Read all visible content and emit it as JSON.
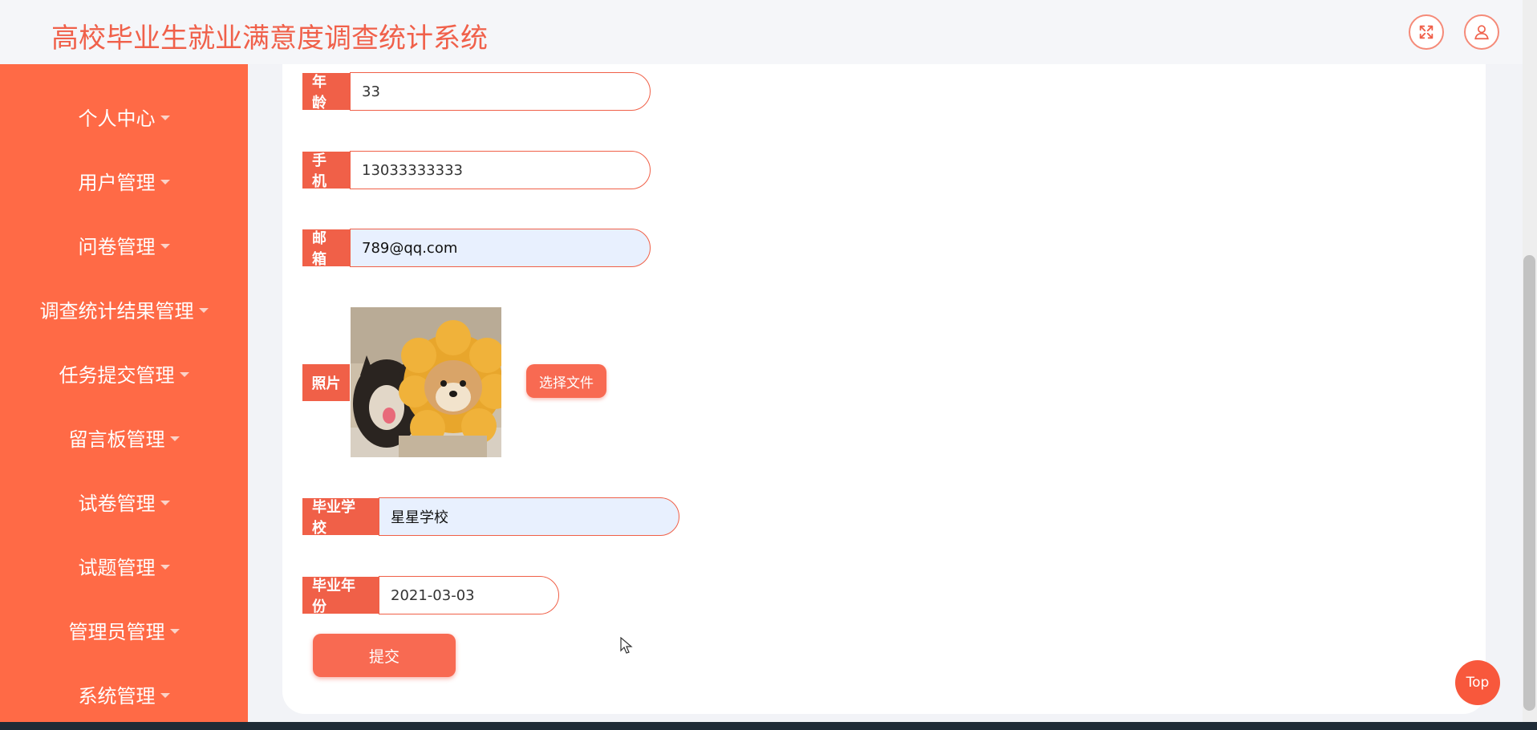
{
  "header": {
    "title": "高校毕业生就业满意度调查统计系统"
  },
  "sidebar": {
    "items": [
      {
        "label": "个人中心"
      },
      {
        "label": "用户管理"
      },
      {
        "label": "问卷管理"
      },
      {
        "label": "调查统计结果管理"
      },
      {
        "label": "任务提交管理"
      },
      {
        "label": "留言板管理"
      },
      {
        "label": "试卷管理"
      },
      {
        "label": "试题管理"
      },
      {
        "label": "管理员管理"
      },
      {
        "label": "系统管理"
      }
    ]
  },
  "form": {
    "age": {
      "label": "年龄",
      "value": "33"
    },
    "phone": {
      "label": "手机",
      "value": "13033333333"
    },
    "email": {
      "label": "邮箱",
      "value": "789@qq.com"
    },
    "photo": {
      "label": "照片",
      "button": "选择文件"
    },
    "school": {
      "label": "毕业学校",
      "value": "星星学校"
    },
    "grad_year": {
      "label": "毕业年份",
      "value": "2021-03-03"
    },
    "submit": "提交"
  },
  "top_button": "Top",
  "colors": {
    "accent": "#f06048",
    "sidebar": "#ff6a46",
    "title": "#f0604a"
  }
}
